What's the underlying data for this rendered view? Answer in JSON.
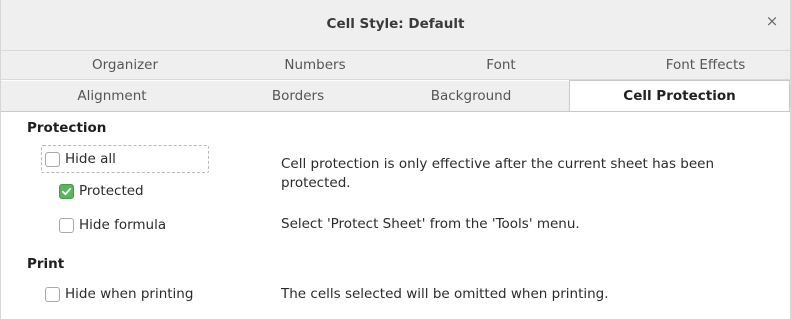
{
  "window": {
    "title": "Cell Style: Default",
    "close_glyph": "×"
  },
  "tabs_row1": [
    "Organizer",
    "Numbers",
    "Font",
    "Font Effects"
  ],
  "tabs_row2": [
    "Alignment",
    "Borders",
    "Background",
    "Cell Protection"
  ],
  "active_tab": "Cell Protection",
  "protection": {
    "heading": "Protection",
    "hide_all": {
      "label": "Hide all",
      "checked": false
    },
    "protected": {
      "label": "Protected",
      "checked": true
    },
    "hide_formula": {
      "label": "Hide formula",
      "checked": false
    },
    "info_1": "Cell protection is only effective after the current sheet has been protected.",
    "info_2": "Select 'Protect Sheet' from the 'Tools' menu."
  },
  "print": {
    "heading": "Print",
    "hide_when_printing": {
      "label": "Hide when printing",
      "checked": false
    },
    "info": "The cells selected will be omitted when printing."
  },
  "colors": {
    "check_accent": "#5ab55a",
    "titlebar_bg": "#efefef"
  }
}
